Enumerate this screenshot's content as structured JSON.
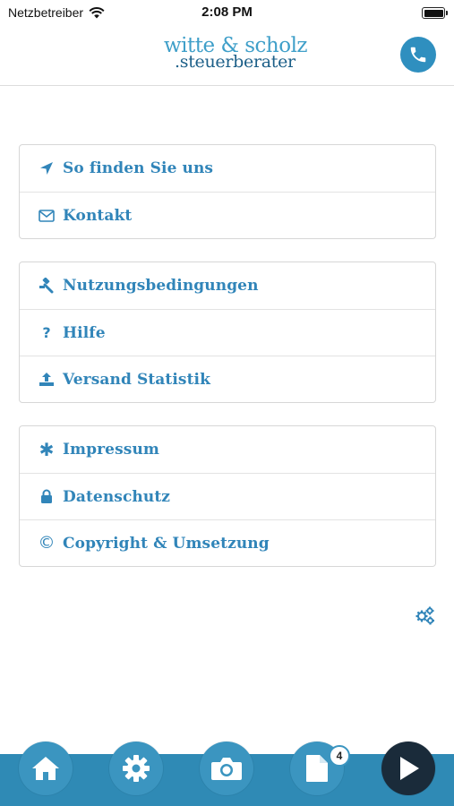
{
  "status_bar": {
    "carrier": "Netzbetreiber",
    "time": "2:08 PM"
  },
  "header": {
    "logo_line1": "witte & scholz",
    "logo_line2": ".steuerberater"
  },
  "menu": {
    "group1": [
      {
        "label": "So finden Sie uns",
        "icon": "location-arrow-icon"
      },
      {
        "label": "Kontakt",
        "icon": "envelope-icon"
      }
    ],
    "group2": [
      {
        "label": "Nutzungsbedingungen",
        "icon": "gavel-icon"
      },
      {
        "label": "Hilfe",
        "icon": "question-icon"
      },
      {
        "label": "Versand Statistik",
        "icon": "upload-icon"
      }
    ],
    "group3": [
      {
        "label": "Impressum",
        "icon": "asterisk-icon"
      },
      {
        "label": "Datenschutz",
        "icon": "lock-icon"
      },
      {
        "label": "Copyright & Umsetzung",
        "icon": "copyright-icon"
      }
    ]
  },
  "tabbar": {
    "documents_badge": "4"
  },
  "colors": {
    "accent": "#3185b9",
    "tabbar": "#2f8ab5",
    "dark_button": "#1a2b3a"
  }
}
